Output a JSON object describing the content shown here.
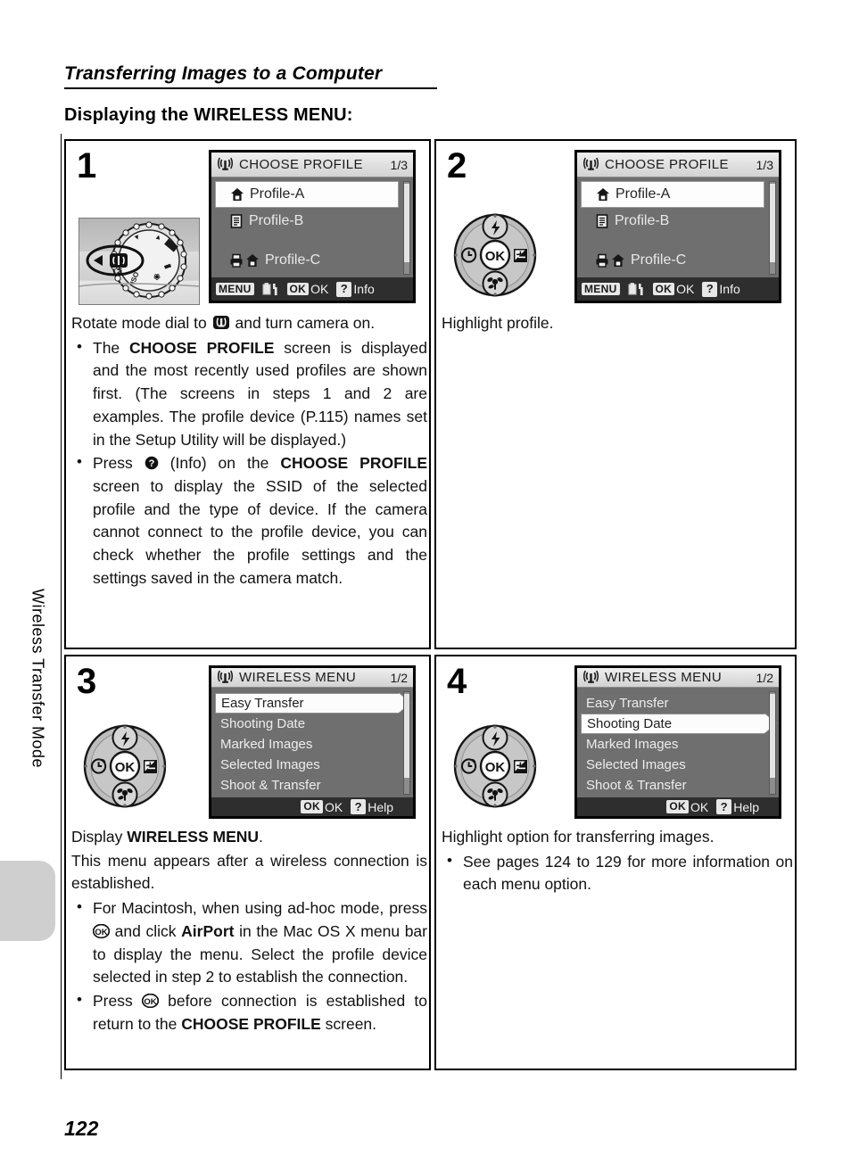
{
  "document": {
    "section_title": "Transferring Images to a Computer",
    "sub_title": "Displaying the WIRELESS MENU:",
    "side_tab_label": "Wireless Transfer Mode",
    "page_number": "122"
  },
  "steps": [
    {
      "number": "1",
      "screen": {
        "kind": "choose-profile",
        "title": "CHOOSE PROFILE",
        "pages": "1/3",
        "rows": [
          {
            "label": "Profile-A",
            "icons": [
              "home-icon"
            ],
            "selected": true
          },
          {
            "label": "Profile-B",
            "icons": [
              "document-icon"
            ],
            "selected": false
          },
          {
            "label": "Profile-C",
            "icons": [
              "printer-icon",
              "home-icon"
            ],
            "selected": false
          }
        ],
        "footer": [
          {
            "badge": "MENU",
            "label": ""
          },
          {
            "badge": "",
            "label": "",
            "icon": "setup-wrench-icon"
          },
          {
            "badge": "OK",
            "label": "OK"
          },
          {
            "badge": "?",
            "label": "Info"
          }
        ]
      },
      "illustration": "mode-dial-photo",
      "caption": "Rotate mode dial to @wifi and turn camera on.",
      "caption_parts": {
        "before": "Rotate mode dial to ",
        "icon": "wireless-mode-icon",
        "after": " and turn camera on."
      },
      "bullets": [
        {
          "parts": [
            {
              "t": "The "
            },
            {
              "t": "CHOOSE PROFILE",
              "b": true
            },
            {
              "t": " screen is displayed and the most recently used profiles are shown first. (The screens in steps 1 and 2 are examples. The profile device (P.115) names set in the Setup Utility will be displayed.)"
            }
          ]
        },
        {
          "parts": [
            {
              "t": "Press "
            },
            {
              "icon": "help-question-icon"
            },
            {
              "t": " (Info) on the "
            },
            {
              "t": "CHOOSE PROFILE",
              "b": true
            },
            {
              "t": " screen to display the SSID of the selected profile and the type of device. If the camera cannot connect to the profile device, you can check whether the profile settings and the settings saved in the camera match."
            }
          ]
        }
      ]
    },
    {
      "number": "2",
      "screen": {
        "kind": "choose-profile",
        "title": "CHOOSE PROFILE",
        "pages": "1/3",
        "rows": [
          {
            "label": "Profile-A",
            "icons": [
              "home-icon"
            ],
            "selected": true
          },
          {
            "label": "Profile-B",
            "icons": [
              "document-icon"
            ],
            "selected": false
          },
          {
            "label": "Profile-C",
            "icons": [
              "printer-icon",
              "home-icon"
            ],
            "selected": false
          }
        ],
        "footer": [
          {
            "badge": "MENU",
            "label": ""
          },
          {
            "badge": "",
            "label": "",
            "icon": "setup-wrench-icon"
          },
          {
            "badge": "OK",
            "label": "OK"
          },
          {
            "badge": "?",
            "label": "Info"
          }
        ]
      },
      "illustration": "multi-selector",
      "caption": "Highlight profile.",
      "bullets": []
    },
    {
      "number": "3",
      "screen": {
        "kind": "wireless-menu",
        "title": "WIRELESS MENU",
        "pages": "1/2",
        "rows": [
          {
            "label": "Easy Transfer",
            "selected": true
          },
          {
            "label": "Shooting Date",
            "selected": false
          },
          {
            "label": "Marked Images",
            "selected": false
          },
          {
            "label": "Selected Images",
            "selected": false
          },
          {
            "label": "Shoot & Transfer",
            "selected": false
          }
        ],
        "footer": [
          {
            "badge": "OK",
            "label": "OK"
          },
          {
            "badge": "?",
            "label": "Help"
          }
        ]
      },
      "illustration": "multi-selector",
      "caption_parts": {
        "before": "Display ",
        "bold": "WIRELESS MENU",
        "after": "."
      },
      "lead": "This menu appears after a wireless connection is established.",
      "bullets": [
        {
          "parts": [
            {
              "t": "For Macintosh, when using ad-hoc mode, press "
            },
            {
              "icon": "ok-button-icon"
            },
            {
              "t": " and click "
            },
            {
              "t": "AirPort",
              "b": true
            },
            {
              "t": " in the Mac OS X menu bar to display the menu. Select the profile device selected in step 2 to establish the connection."
            }
          ]
        },
        {
          "parts": [
            {
              "t": "Press "
            },
            {
              "icon": "ok-button-icon"
            },
            {
              "t": " before connection is established to return to the "
            },
            {
              "t": "CHOOSE PROFILE",
              "b": true
            },
            {
              "t": " screen."
            }
          ]
        }
      ]
    },
    {
      "number": "4",
      "screen": {
        "kind": "wireless-menu",
        "title": "WIRELESS MENU",
        "pages": "1/2",
        "rows": [
          {
            "label": "Easy Transfer",
            "selected": false
          },
          {
            "label": "Shooting Date",
            "selected": true
          },
          {
            "label": "Marked Images",
            "selected": false
          },
          {
            "label": "Selected Images",
            "selected": false
          },
          {
            "label": "Shoot & Transfer",
            "selected": false
          }
        ],
        "footer": [
          {
            "badge": "OK",
            "label": "OK"
          },
          {
            "badge": "?",
            "label": "Help"
          }
        ]
      },
      "illustration": "multi-selector",
      "caption": "Highlight option for transferring images.",
      "bullets": [
        {
          "parts": [
            {
              "t": "See pages 124 to 129 for more information on each menu option."
            }
          ]
        }
      ]
    }
  ],
  "icons": {
    "wireless": "wireless-antenna-icon",
    "flash": "flash-icon",
    "self_timer": "self-timer-icon",
    "ok": "ok-icon",
    "exposure": "exposure-compensation-icon",
    "macro": "macro-flower-icon"
  },
  "colors": {
    "lcd_background": "#6f6f6f",
    "lcd_header": "#e2e2e2",
    "lcd_footer": "#2e2e2e",
    "selection": "#fdfdfd",
    "side_tab": "#cfcfcf",
    "ink": "#000000"
  }
}
